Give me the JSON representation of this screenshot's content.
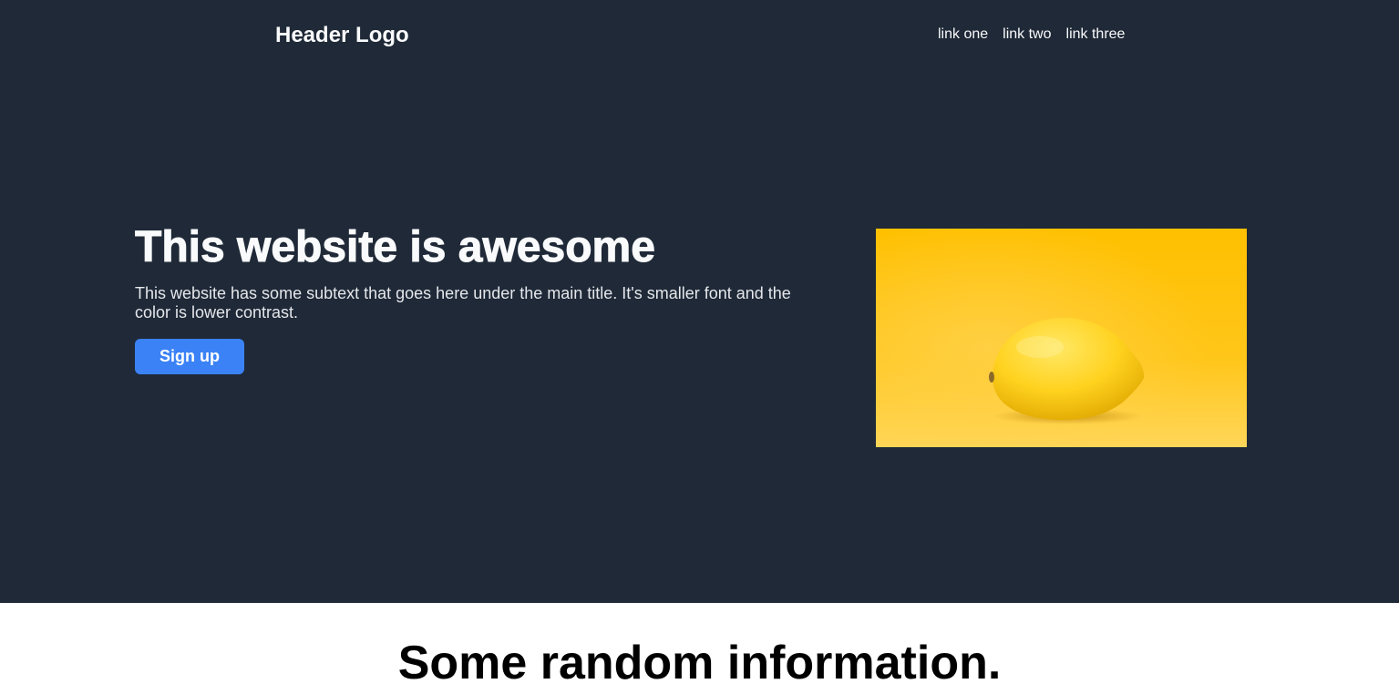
{
  "header": {
    "logo": "Header Logo",
    "nav": [
      "link one",
      "link two",
      "link three"
    ]
  },
  "hero": {
    "title": "This website is awesome",
    "subtext": "This website has some subtext that goes here under the main title. It's smaller font and the color is lower contrast.",
    "button_label": "Sign up",
    "image": "lemon-on-yellow-background"
  },
  "info": {
    "heading": "Some random information."
  },
  "colors": {
    "hero_background": "#1f2937",
    "accent": "#3b82f6",
    "image_background": "#ffc107"
  }
}
